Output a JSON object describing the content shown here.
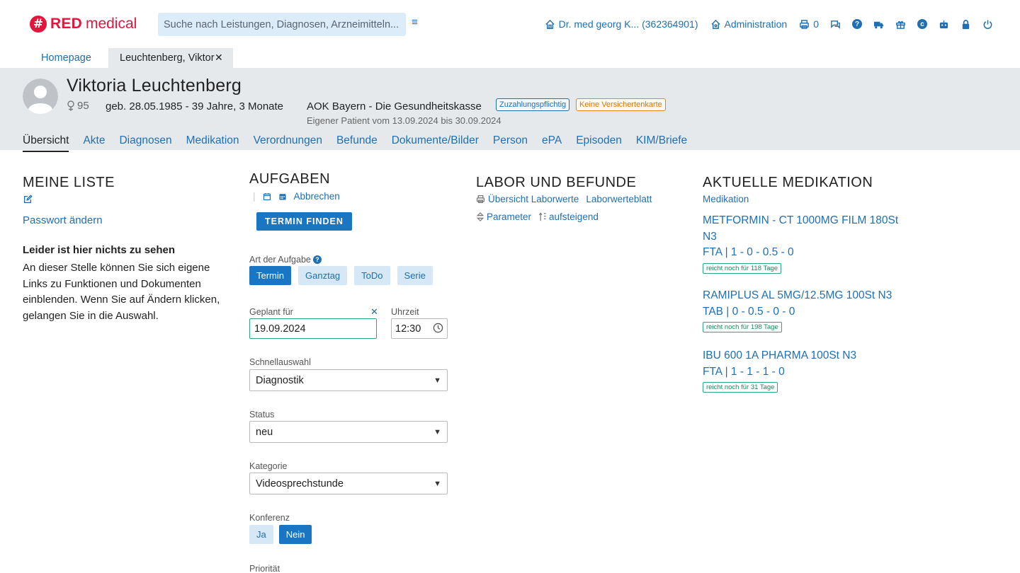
{
  "brand": {
    "mark": "#",
    "red": "RED",
    "medical": "medical",
    "color": "#e3173e"
  },
  "search": {
    "placeholder": "Suche nach Leistungen, Diagnosen, Arzneimitteln..."
  },
  "topnav": {
    "doctor": "Dr. med georg K... (362364901)",
    "administration": "Administration",
    "print_count": "0",
    "icons": [
      "print-icon",
      "chat-icon",
      "help-icon",
      "truck-icon",
      "gift-icon",
      "copyright-icon",
      "robot-icon",
      "lock-icon",
      "power-icon"
    ]
  },
  "tabs": {
    "home": "Homepage",
    "active": "Leuchtenberg, Viktor",
    "close": "✕"
  },
  "patient": {
    "name": "Viktoria Leuchtenberg",
    "gender_number": "95",
    "birth": "geb. 28.05.1985 - 39 Jahre, 3 Monate",
    "insurer": "AOK Bayern - Die Gesundheitskasse",
    "badge_copay": "Zuzahlungspflichtig",
    "badge_card": "Keine Versichertenkarte",
    "status": "Eigener Patient vom 13.09.2024 bis 30.09.2024",
    "tabs": [
      "Übersicht",
      "Akte",
      "Diagnosen",
      "Medikation",
      "Verordnungen",
      "Befunde",
      "Dokumente/Bilder",
      "Person",
      "ePA",
      "Episoden",
      "KIM/Briefe"
    ]
  },
  "meine_liste": {
    "title": "MEINE LISTE",
    "link": "Passwort ändern",
    "empty_title": "Leider ist hier nichts zu sehen",
    "empty_text": "An dieser Stelle können Sie sich eigene Links zu Funktionen und Dokumenten einblenden. Wenn Sie auf Ändern klicken, gelangen Sie in die Auswahl."
  },
  "aufgaben": {
    "title": "AUFGABEN",
    "cancel": "Abbrechen",
    "find_button": "TERMIN FINDEN",
    "type_label": "Art der Aufgabe",
    "types": [
      "Termin",
      "Ganztag",
      "ToDo",
      "Serie"
    ],
    "selected_type": "Termin",
    "planned_label": "Geplant für",
    "planned_value": "19.09.2024",
    "time_label": "Uhrzeit",
    "time_value": "12:30",
    "quick_label": "Schnellauswahl",
    "quick_value": "Diagnostik",
    "status_label": "Status",
    "status_value": "neu",
    "category_label": "Kategorie",
    "category_value": "Videosprechstunde",
    "conference_label": "Konferenz",
    "conference_yes": "Ja",
    "conference_no": "Nein",
    "priority_label": "Priorität"
  },
  "labor": {
    "title": "LABOR UND BEFUNDE",
    "overview": "Übersicht Laborwerte",
    "sheet": "Laborwerteblatt",
    "param": "Parameter",
    "sort": "aufsteigend"
  },
  "medikation": {
    "title": "AKTUELLE MEDIKATION",
    "sub": "Medikation",
    "items": [
      {
        "name": "METFORMIN - CT 1000MG FILM 180St N3",
        "dose": "FTA | 1 - 0 - 0.5 - 0",
        "tag": "reicht noch für 118 Tage"
      },
      {
        "name": "RAMIPLUS AL 5MG/12.5MG 100St N3",
        "dose": "TAB | 0 - 0.5 - 0 - 0",
        "tag": "reicht noch für 198 Tage"
      },
      {
        "name": "IBU 600 1A PHARMA 100St N3",
        "dose": "FTA | 1 - 1 - 1 - 0",
        "tag": "reicht noch für 31 Tage"
      }
    ]
  },
  "colors": {
    "accent": "#1f6fb4",
    "primary_button": "#1a76c2",
    "header_bg": "#e6e9ec",
    "green": "#2ea682"
  }
}
